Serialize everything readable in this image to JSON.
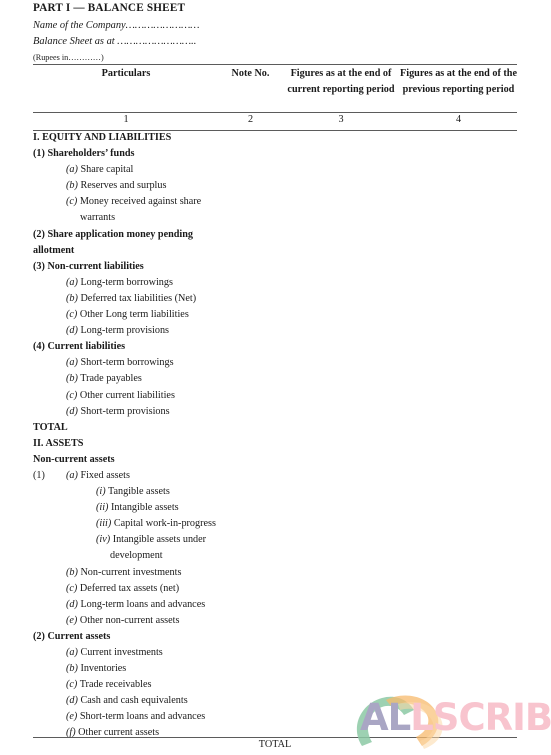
{
  "document": {
    "title": "PART I — BALANCE SHEET",
    "company_line": "Name of the Company……………………",
    "date_line": "Balance Sheet as at ……………………..",
    "units_line": "(Rupees in…………)"
  },
  "table": {
    "headers": {
      "particulars": "Particulars",
      "note_no": "Note No.",
      "current_period": "Figures as at the end of current reporting period",
      "previous_period": "Figures as at the end of the previous reporting period"
    },
    "column_numbers": [
      "1",
      "2",
      "3",
      "4"
    ],
    "footer_total": "TOTAL"
  },
  "sections": [
    {
      "marker": "I.",
      "label": "EQUITY AND LIABILITIES",
      "style": "heading"
    },
    {
      "marker": "(1)",
      "label": "Shareholders’ funds",
      "style": "group"
    },
    {
      "marker": "(a)",
      "label": "Share capital",
      "style": "item"
    },
    {
      "marker": "(b)",
      "label": "Reserves and surplus",
      "style": "item"
    },
    {
      "marker": "(c)",
      "label": "Money received against share",
      "style": "item"
    },
    {
      "marker": "",
      "label": "warrants",
      "style": "wrap"
    },
    {
      "marker": "(2)",
      "label": "Share application money pending",
      "style": "group"
    },
    {
      "marker": "",
      "label": "allotment",
      "style": "group-wrap"
    },
    {
      "marker": "(3)",
      "label": "Non-current liabilities",
      "style": "group"
    },
    {
      "marker": "(a)",
      "label": "Long-term borrowings",
      "style": "item"
    },
    {
      "marker": "(b)",
      "label": "Deferred tax liabilities (Net)",
      "style": "item"
    },
    {
      "marker": "(c)",
      "label": "Other Long term liabilities",
      "style": "item"
    },
    {
      "marker": "(d)",
      "label": "Long-term provisions",
      "style": "item"
    },
    {
      "marker": "(4)",
      "label": "Current liabilities",
      "style": "group"
    },
    {
      "marker": "(a)",
      "label": "Short-term borrowings",
      "style": "item"
    },
    {
      "marker": "(b)",
      "label": "Trade payables",
      "style": "item"
    },
    {
      "marker": "(c)",
      "label": "Other current liabilities",
      "style": "item"
    },
    {
      "marker": "(d)",
      "label": "Short-term provisions",
      "style": "item"
    },
    {
      "marker": "",
      "label": "TOTAL",
      "style": "total"
    },
    {
      "marker": "II.",
      "label": "ASSETS",
      "style": "heading"
    },
    {
      "marker": "",
      "label": "Non-current assets",
      "style": "subheading"
    },
    {
      "marker": "(1)",
      "label": "",
      "style": "number-only"
    },
    {
      "marker": "(a)",
      "label": "Fixed assets",
      "style": "item-inline"
    },
    {
      "marker": "(i)",
      "label": "Tangible assets",
      "style": "subitem"
    },
    {
      "marker": "(ii)",
      "label": "Intangible assets",
      "style": "subitem"
    },
    {
      "marker": "(iii)",
      "label": "Capital work-in-progress",
      "style": "subitem"
    },
    {
      "marker": "(iv)",
      "label": "Intangible assets under",
      "style": "subitem"
    },
    {
      "marker": "",
      "label": "development",
      "style": "subitem-wrap"
    },
    {
      "marker": "(b)",
      "label": "Non-current investments",
      "style": "item"
    },
    {
      "marker": "(c)",
      "label": "Deferred tax assets (net)",
      "style": "item"
    },
    {
      "marker": "(d)",
      "label": "Long-term loans and advances",
      "style": "item"
    },
    {
      "marker": "(e)",
      "label": "Other non-current assets",
      "style": "item"
    },
    {
      "marker": "(2)",
      "label": "Current assets",
      "style": "group"
    },
    {
      "marker": "(a)",
      "label": "Current investments",
      "style": "item"
    },
    {
      "marker": "(b)",
      "label": "Inventories",
      "style": "item"
    },
    {
      "marker": "(c)",
      "label": "Trade receivables",
      "style": "item"
    },
    {
      "marker": "(d)",
      "label": "Cash and cash equivalents",
      "style": "item"
    },
    {
      "marker": "(e)",
      "label": "Short-term loans and advances",
      "style": "item"
    },
    {
      "marker": "(f)",
      "label": "Other current assets",
      "style": "item"
    }
  ],
  "watermark": {
    "text_part1": "AL",
    "text_part2": "LSCRIBE",
    "color_part1": "#a9a6c4",
    "color_part2": "#f8c4ce",
    "swoosh_green": "#7fc49a",
    "swoosh_orange": "#f5b66a"
  }
}
